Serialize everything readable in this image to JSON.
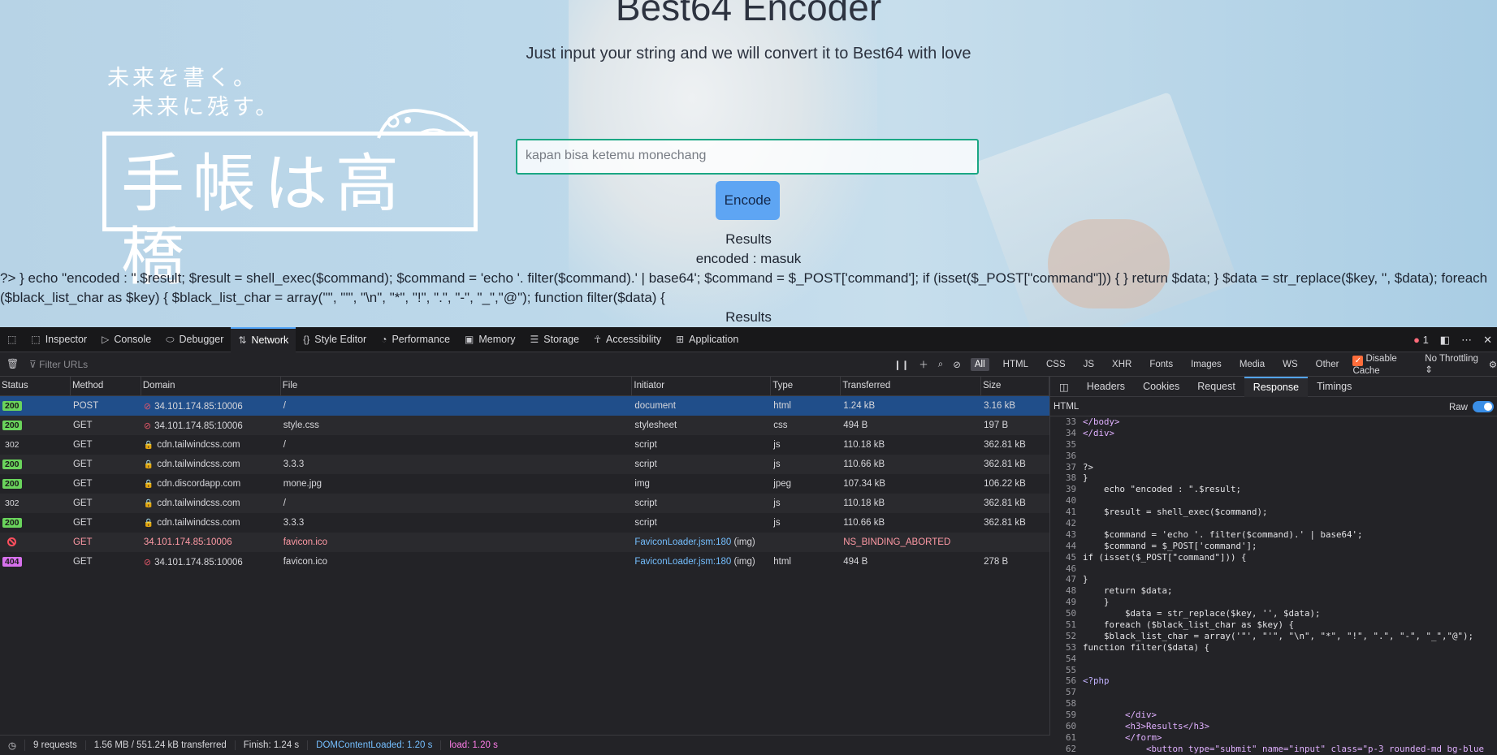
{
  "page": {
    "title": "Best64 Encoder",
    "subtitle": "Just input your string and we will convert it to Best64 with love",
    "logo_line1": "未来を書く。",
    "logo_line2": "未来に残す。",
    "logo_big": "手帳は高橋",
    "input_value": "kapan bisa ketemu monechang",
    "encode_label": "Encode",
    "results1": "Results",
    "encoded_text": "encoded : masuk",
    "code_line1": "?> } echo \"encoded : \".$result; $result = shell_exec($command); $command = 'echo '. filter($command).' | base64'; $command = $_POST['command']; if (isset($_POST[\"command\"])) { } return $data; } $data = str_replace($key, '', $data); foreach",
    "code_line2": "($black_list_char as $key) { $black_list_char = array('\"', \"'\", \"\\n\", \"*\", \"!\", \".\", \"-\", \"_\",\"@\"); function filter($data) {",
    "results2": "Results"
  },
  "devtools": {
    "tabs": [
      "Inspector",
      "Console",
      "Debugger",
      "Network",
      "Style Editor",
      "Performance",
      "Memory",
      "Storage",
      "Accessibility",
      "Application"
    ],
    "error_count": "1",
    "filter_placeholder": "Filter URLs",
    "type_filters": [
      "All",
      "HTML",
      "CSS",
      "JS",
      "XHR",
      "Fonts",
      "Images",
      "Media",
      "WS",
      "Other"
    ],
    "disable_cache": "Disable Cache",
    "throttling": "No Throttling",
    "columns": [
      "Status",
      "Method",
      "Domain",
      "File",
      "Initiator",
      "Type",
      "Transferred",
      "Size"
    ],
    "requests": [
      {
        "status": "200",
        "method": "POST",
        "domain": "34.101.174.85:10006",
        "file": "/",
        "initiator": "document",
        "type": "html",
        "transferred": "1.24 kB",
        "size": "3.16 kB"
      },
      {
        "status": "200",
        "method": "GET",
        "domain": "34.101.174.85:10006",
        "file": "style.css",
        "initiator": "stylesheet",
        "type": "css",
        "transferred": "494 B",
        "size": "197 B"
      },
      {
        "status": "302",
        "method": "GET",
        "domain": "cdn.tailwindcss.com",
        "file": "/",
        "initiator": "script",
        "type": "js",
        "transferred": "110.18 kB",
        "size": "362.81 kB"
      },
      {
        "status": "200",
        "method": "GET",
        "domain": "cdn.tailwindcss.com",
        "file": "3.3.3",
        "initiator": "script",
        "type": "js",
        "transferred": "110.66 kB",
        "size": "362.81 kB"
      },
      {
        "status": "200",
        "method": "GET",
        "domain": "cdn.discordapp.com",
        "file": "mone.jpg",
        "initiator": "img",
        "type": "jpeg",
        "transferred": "107.34 kB",
        "size": "106.22 kB"
      },
      {
        "status": "302",
        "method": "GET",
        "domain": "cdn.tailwindcss.com",
        "file": "/",
        "initiator": "script",
        "type": "js",
        "transferred": "110.18 kB",
        "size": "362.81 kB"
      },
      {
        "status": "200",
        "method": "GET",
        "domain": "cdn.tailwindcss.com",
        "file": "3.3.3",
        "initiator": "script",
        "type": "js",
        "transferred": "110.66 kB",
        "size": "362.81 kB"
      },
      {
        "status": "",
        "method": "GET",
        "domain": "34.101.174.85:10006",
        "file": "favicon.ico",
        "initiator_link": "FaviconLoader.jsm:180",
        "initiator_suffix": " (img)",
        "type": "",
        "transferred": "NS_BINDING_ABORTED",
        "size": ""
      },
      {
        "status": "404",
        "method": "GET",
        "domain": "34.101.174.85:10006",
        "file": "favicon.ico",
        "initiator_link": "FaviconLoader.jsm:180",
        "initiator_suffix": " (img)",
        "type": "html",
        "transferred": "494 B",
        "size": "278 B"
      }
    ],
    "status_bar": {
      "requests": "9 requests",
      "transferred": "1.56 MB / 551.24 kB transferred",
      "finish": "Finish: 1.24 s",
      "dom": "DOMContentLoaded: 1.20 s",
      "load": "load: 1.20 s"
    },
    "side_tabs": [
      "Headers",
      "Cookies",
      "Request",
      "Response",
      "Timings"
    ],
    "response_type": "HTML",
    "raw_label": "Raw",
    "code_lines": [
      {
        "n": "33",
        "t": "</body>"
      },
      {
        "n": "34",
        "t": "</div>"
      },
      {
        "n": "35",
        "t": ""
      },
      {
        "n": "36",
        "t": ""
      },
      {
        "n": "37",
        "t": "?>"
      },
      {
        "n": "38",
        "t": "}"
      },
      {
        "n": "39",
        "t": "    echo \"encoded : \".$result;"
      },
      {
        "n": "40",
        "t": ""
      },
      {
        "n": "41",
        "t": "    $result = shell_exec($command);"
      },
      {
        "n": "42",
        "t": ""
      },
      {
        "n": "43",
        "t": "    $command = 'echo '. filter($command).' | base64';"
      },
      {
        "n": "44",
        "t": "    $command = $_POST['command'];"
      },
      {
        "n": "45",
        "t": "if (isset($_POST[\"command\"])) {"
      },
      {
        "n": "46",
        "t": ""
      },
      {
        "n": "47",
        "t": "}"
      },
      {
        "n": "48",
        "t": "    return $data;"
      },
      {
        "n": "49",
        "t": "    }"
      },
      {
        "n": "50",
        "t": "        $data = str_replace($key, '', $data);"
      },
      {
        "n": "51",
        "t": "    foreach ($black_list_char as $key) {"
      },
      {
        "n": "52",
        "t": "    $black_list_char = array('\"', \"'\", \"\\n\", \"*\", \"!\", \".\", \"-\", \"_\",\"@\");"
      },
      {
        "n": "53",
        "t": "function filter($data) {"
      },
      {
        "n": "54",
        "t": ""
      },
      {
        "n": "55",
        "t": ""
      },
      {
        "n": "56",
        "t": "<?php"
      },
      {
        "n": "57",
        "t": ""
      },
      {
        "n": "58",
        "t": ""
      },
      {
        "n": "59",
        "t": "        </div>"
      },
      {
        "n": "60",
        "t": "        <h3>Results</h3>"
      },
      {
        "n": "61",
        "t": "        </form>"
      },
      {
        "n": "62",
        "t": "            <button type=\"submit\" name=\"input\" class=\"p-3 rounded-md bg-blue"
      }
    ]
  }
}
